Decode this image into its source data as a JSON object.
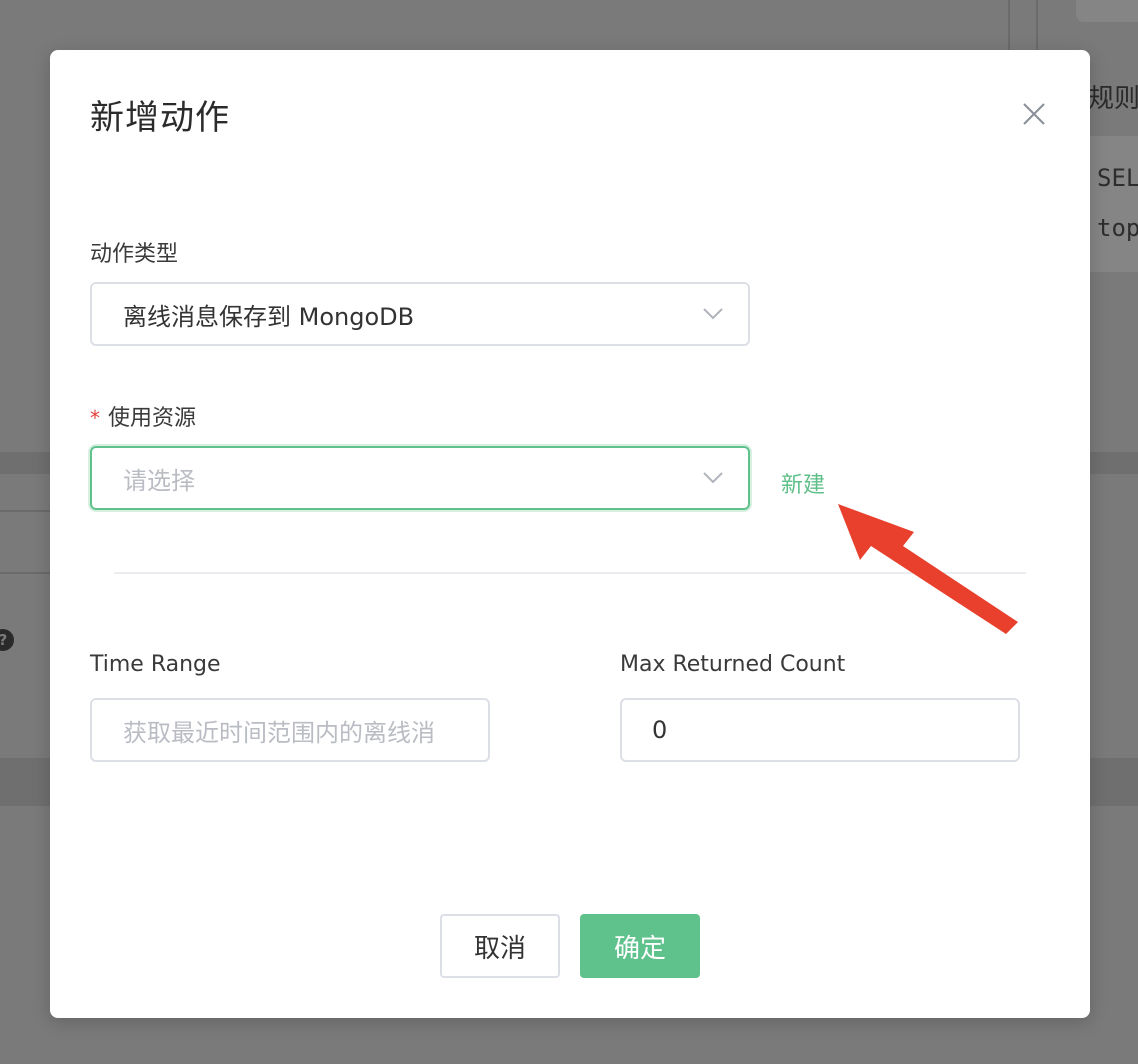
{
  "background": {
    "right_heading_fragment": "规则",
    "code_line_1": "SEL",
    "code_line_2": "top",
    "help_icon_glyph": "?"
  },
  "modal": {
    "title": "新增动作",
    "close_icon": "close-icon"
  },
  "form": {
    "action_type": {
      "label": "动作类型",
      "value": "离线消息保存到 MongoDB"
    },
    "resource": {
      "required_mark": "*",
      "label": "使用资源",
      "placeholder": "请选择",
      "new_link": "新建"
    },
    "time_range": {
      "label": "Time Range",
      "placeholder": "获取最近时间范围内的离线消"
    },
    "max_returned_count": {
      "label": "Max Returned Count",
      "value": "0"
    }
  },
  "footer": {
    "cancel_label": "取消",
    "confirm_label": "确定"
  },
  "colors": {
    "accent": "#5fc28d",
    "required": "#e0443a",
    "annotation_arrow": "#e8402c"
  }
}
